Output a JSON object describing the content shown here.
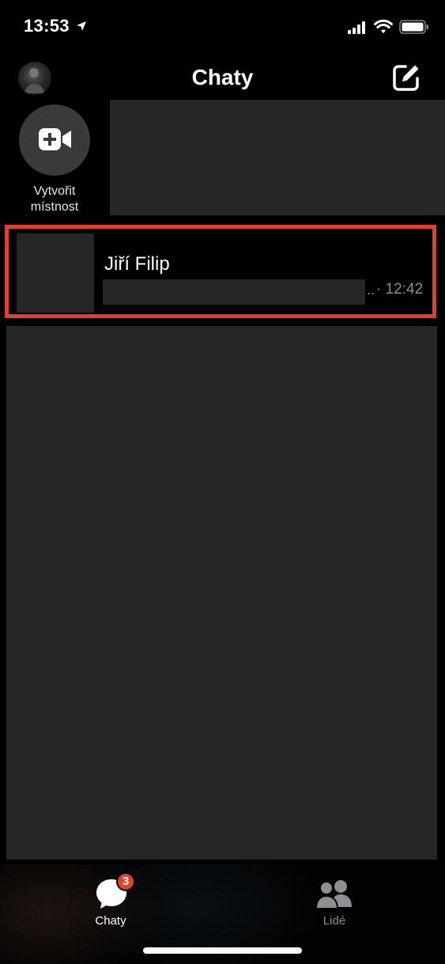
{
  "status_bar": {
    "time": "13:53"
  },
  "header": {
    "title": "Chaty"
  },
  "create_room": {
    "label_line1": "Vytvořit",
    "label_line2": "místnost"
  },
  "chats": [
    {
      "name": "Jiří Filip",
      "ellipsis": "..",
      "time": "· 12:42"
    }
  ],
  "tabbar": {
    "chats": {
      "label": "Chaty",
      "badge": "3"
    },
    "people": {
      "label": "Lidé"
    }
  },
  "colors": {
    "accent": "#e1402d",
    "placeholder": "#262626",
    "secondary_text": "#8e8e93"
  },
  "icons": [
    "location-arrow-icon",
    "signal-icon",
    "wifi-icon",
    "battery-icon",
    "compose-icon",
    "video-plus-icon",
    "chat-bubble-icon",
    "people-icon"
  ]
}
